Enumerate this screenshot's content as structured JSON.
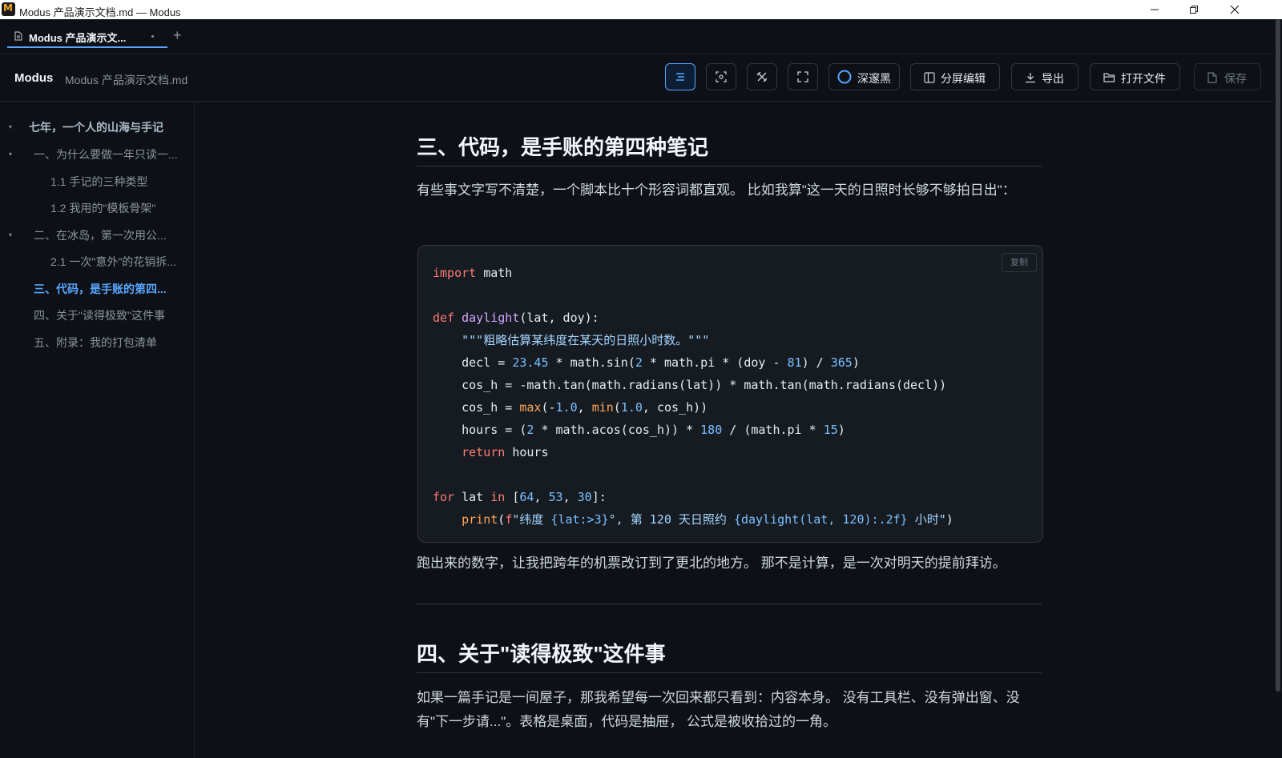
{
  "window": {
    "title": "Modus 产品演示文档.md — Modus",
    "app_icon_letter": "M"
  },
  "tabs": [
    {
      "label": "Modus 产品演示文...",
      "active": true
    }
  ],
  "new_tab_label": "+",
  "header": {
    "brand": "Modus",
    "filename": "Modus 产品演示文档.md",
    "buttons": {
      "theme": "深邃黑",
      "split": "分屏编辑",
      "export": "导出",
      "open": "打开文件",
      "save": "保存"
    }
  },
  "toc": [
    {
      "label": "七年，一个人的山海与手记",
      "level": 1,
      "collapsible": true
    },
    {
      "label": "一、为什么要做一年只读一...",
      "level": 2,
      "collapsible": true
    },
    {
      "label": "1.1 手记的三种类型",
      "level": 3
    },
    {
      "label": "1.2 我用的\"模板骨架\"",
      "level": 3
    },
    {
      "label": "二、在冰岛，第一次用公...",
      "level": 2,
      "collapsible": true
    },
    {
      "label": "2.1 一次\"意外\"的花销拆...",
      "level": 3
    },
    {
      "label": "三、代码，是手账的第四...",
      "level": 2,
      "active": true
    },
    {
      "label": "四、关于\"读得极致\"这件事",
      "level": 2
    },
    {
      "label": "五、附录：我的打包清单",
      "level": 2
    }
  ],
  "doc": {
    "section3_title": "三、代码，是手账的第四种笔记",
    "section3_intro": "有些事文字写不清楚，一个脚本比十个形容词都直观。 比如我算\"这一天的日照时长够不够拍日出\"：",
    "copy_label": "复制",
    "code_language": "python",
    "code": "import math\n\ndef daylight(lat, doy):\n    \"\"\"粗略估算某纬度在某天的日照小时数。\"\"\"\n    decl = 23.45 * math.sin(2 * math.pi * (doy - 81) / 365)\n    cos_h = -math.tan(math.radians(lat)) * math.tan(math.radians(decl))\n    cos_h = max(-1.0, min(1.0, cos_h))\n    hours = (2 * math.acos(cos_h)) * 180 / (math.pi * 15)\n    return hours\n\nfor lat in [64, 53, 30]:\n    print(f\"纬度 {lat:>3}°, 第 120 天日照约 {daylight(lat, 120):.2f} 小时\")",
    "section3_after": "跑出来的数字，让我把跨年的机票改订到了更北的地方。 那不是计算，是一次对明天的提前拜访。",
    "section4_title": "四、关于\"读得极致\"这件事",
    "section4_para": "如果一篇手记是一间屋子，那我希望每一次回来都只看到：内容本身。 没有工具栏、没有弹出窗、没有\"下一步请...\"。表格是桌面，代码是抽屉， 公式是被收拾过的一角。"
  },
  "colors": {
    "background": "#0d1117",
    "accent": "#58a6ff",
    "keyword": "#ff7b72",
    "function": "#d2a8ff",
    "number": "#79c0ff"
  }
}
